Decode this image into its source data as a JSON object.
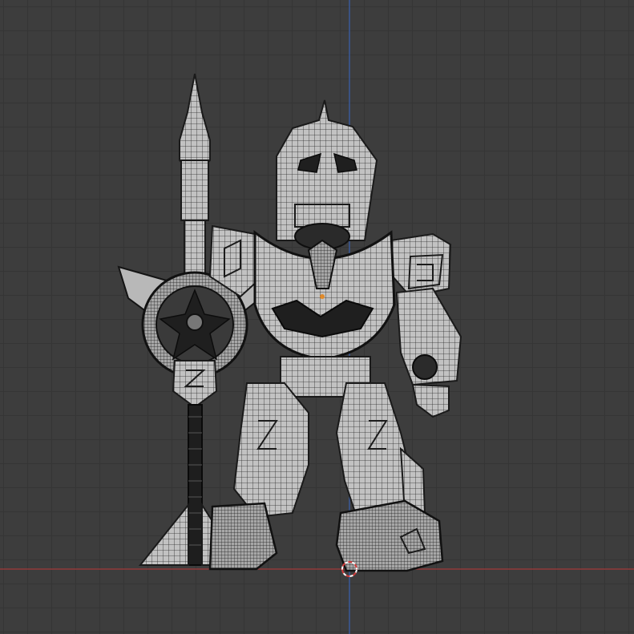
{
  "viewport": {
    "background": "#3d3d3d",
    "grid_color": "#353535",
    "axis_x_color": "#a33a3a",
    "axis_y_color": "#3a5fa8",
    "origin_cursor_colors": [
      "#d23b3b",
      "#ffffff"
    ]
  },
  "scene": {
    "object": "robot-wireframe-model",
    "shading": "wireframe-overlay"
  }
}
